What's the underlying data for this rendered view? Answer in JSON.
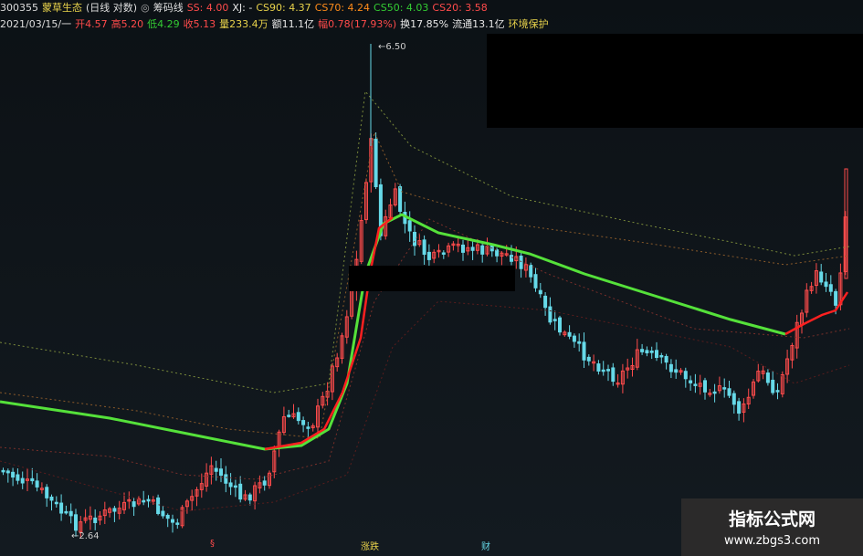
{
  "header": {
    "line1": [
      {
        "text": "300355",
        "color": "#dddddd"
      },
      {
        "text": "蒙草生态",
        "color": "#e8d24b"
      },
      {
        "text": "(日线 对数)",
        "color": "#dddddd"
      },
      {
        "text": "◎",
        "color": "#aaaaaa"
      },
      {
        "text": "筹码线",
        "color": "#dddddd"
      },
      {
        "text": "SS: 4.00",
        "color": "#ff4b4b"
      },
      {
        "text": "XJ: -",
        "color": "#e8e8e8"
      },
      {
        "text": "CS90: 4.37",
        "color": "#e8d24b"
      },
      {
        "text": "CS70: 4.24",
        "color": "#ff8c1a"
      },
      {
        "text": "CS50: 4.03",
        "color": "#33cc33"
      },
      {
        "text": "CS20: 3.58",
        "color": "#ff4b4b"
      }
    ],
    "line2": [
      {
        "text": "2021/03/15/一",
        "color": "#dddddd"
      },
      {
        "text": "开4.57",
        "color": "#ff4b4b"
      },
      {
        "text": "高5.20",
        "color": "#ff4b4b"
      },
      {
        "text": "低4.29",
        "color": "#33cc33"
      },
      {
        "text": "收5.13",
        "color": "#ff4b4b"
      },
      {
        "text": "量233.4万",
        "color": "#e8d24b"
      },
      {
        "text": "额11.1亿",
        "color": "#e8e8e8"
      },
      {
        "text": "幅0.78(17.93%)",
        "color": "#ff4b4b"
      },
      {
        "text": "换17.85%",
        "color": "#e8e8e8"
      },
      {
        "text": "流通13.1亿",
        "color": "#e8e8e8"
      },
      {
        "text": "环境保护",
        "color": "#e8d24b"
      }
    ]
  },
  "annotations": {
    "high": "6.50",
    "low": "2.64"
  },
  "bottom_markers": [
    {
      "text": "§",
      "color": "#ff4b4b"
    },
    {
      "text": "涨跌",
      "color": "#e8d24b"
    },
    {
      "text": "财",
      "color": "#66d9e8"
    }
  ],
  "watermark": {
    "title": "指标公式网",
    "url": "www.zbgs3.com"
  },
  "colors": {
    "up": "#ff4b4b",
    "down": "#66d9e8",
    "cs50": "#55e13a",
    "ss": "#ff2020"
  },
  "chart_data": {
    "type": "candlestick",
    "series": [
      {
        "name": "SS",
        "color": "#ff2020"
      },
      {
        "name": "CS90",
        "color": "#e8d24b"
      },
      {
        "name": "CS70",
        "color": "#ff8c1a"
      },
      {
        "name": "CS50",
        "color": "#33cc33"
      },
      {
        "name": "CS20",
        "color": "#ff4b4b"
      }
    ],
    "high": 6.5,
    "low": 2.64,
    "last_close": 5.13
  }
}
